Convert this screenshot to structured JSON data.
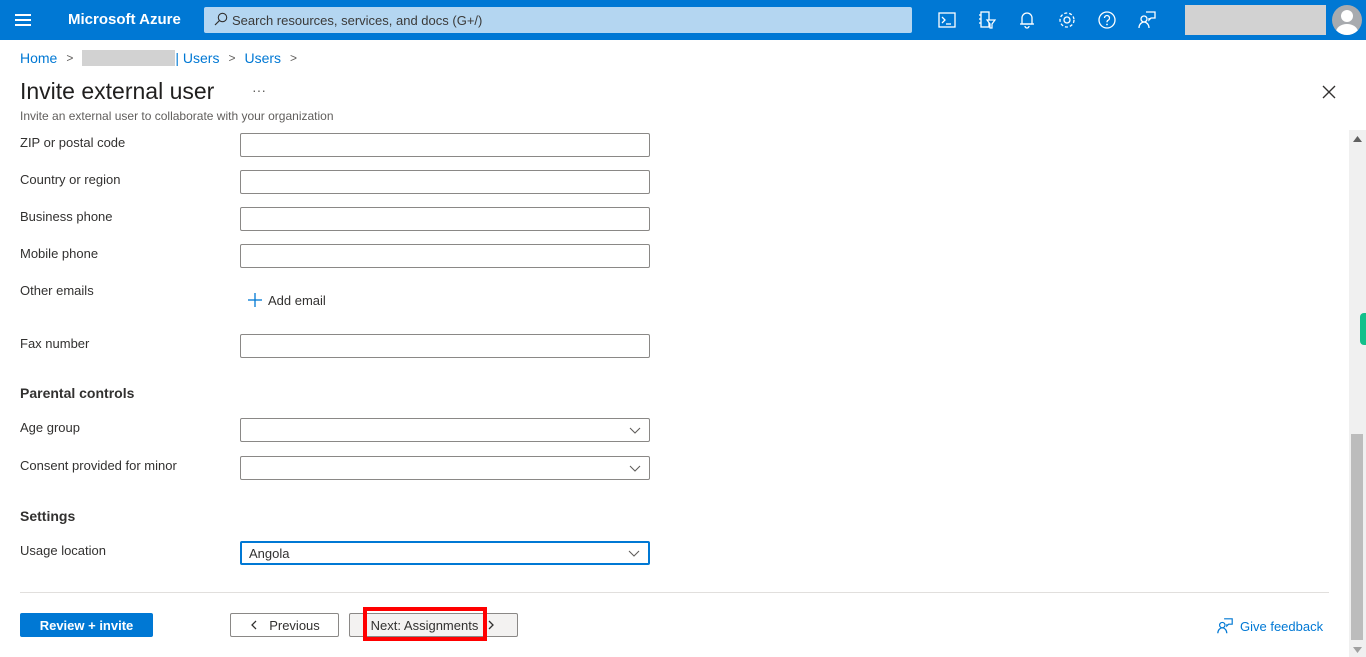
{
  "topbar": {
    "brand": "Microsoft Azure",
    "search_placeholder": "Search resources, services, and docs (G+/)",
    "icons": [
      "cloud-shell-icon",
      "directory-filter-icon",
      "notifications-icon",
      "settings-icon",
      "help-icon",
      "feedback-icon"
    ]
  },
  "breadcrumb": {
    "items": [
      "Home",
      "| Users",
      "Users"
    ]
  },
  "page": {
    "title": "Invite external user",
    "more": "···",
    "subtitle": "Invite an external user to collaborate with your organization"
  },
  "form": {
    "fields": [
      {
        "label": "ZIP or postal code",
        "value": ""
      },
      {
        "label": "Country or region",
        "value": ""
      },
      {
        "label": "Business phone",
        "value": ""
      },
      {
        "label": "Mobile phone",
        "value": ""
      },
      {
        "label": "Other emails",
        "action": "Add email"
      },
      {
        "label": "Fax number",
        "value": ""
      }
    ],
    "parental_controls": {
      "heading": "Parental controls",
      "age_group": {
        "label": "Age group",
        "value": ""
      },
      "consent": {
        "label": "Consent provided for minor",
        "value": ""
      }
    },
    "settings": {
      "heading": "Settings",
      "usage_location": {
        "label": "Usage location",
        "value": "Angola"
      }
    }
  },
  "footer": {
    "review_invite": "Review + invite",
    "previous": "Previous",
    "next": "Next: Assignments",
    "feedback": "Give feedback"
  },
  "colors": {
    "accent": "#0078d4",
    "highlight": "#ff0000"
  }
}
